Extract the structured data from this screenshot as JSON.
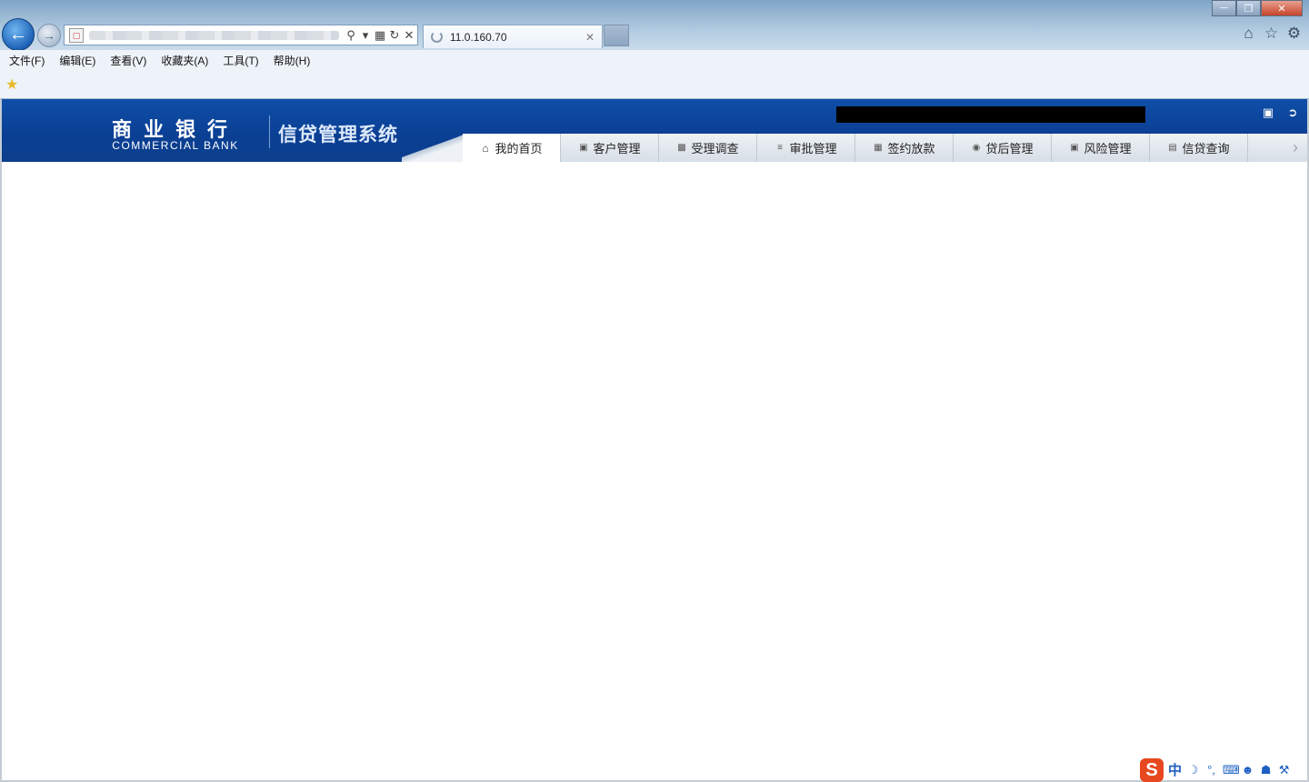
{
  "browser": {
    "tab_title": "11.0.160.70",
    "menu": [
      "文件(F)",
      "编辑(E)",
      "查看(V)",
      "收藏夹(A)",
      "工具(T)",
      "帮助(H)"
    ]
  },
  "app": {
    "brand_cn": "商业银行",
    "brand_en": "COMMERCIAL BANK",
    "system_name": "信贷管理系统",
    "nav_tabs": [
      {
        "label": "我的首页",
        "icon": "home-icon",
        "active": true
      },
      {
        "label": "客户管理",
        "icon": "customer-icon",
        "active": false
      },
      {
        "label": "受理调查",
        "icon": "survey-icon",
        "active": false
      },
      {
        "label": "审批管理",
        "icon": "approval-icon",
        "active": false
      },
      {
        "label": "签约放款",
        "icon": "contract-icon",
        "active": false
      },
      {
        "label": "贷后管理",
        "icon": "postloan-icon",
        "active": false
      },
      {
        "label": "风险管理",
        "icon": "risk-icon",
        "active": false
      },
      {
        "label": "信贷查询",
        "icon": "query-icon",
        "active": false
      }
    ]
  },
  "ime": {
    "logo": "S",
    "mode": "中"
  },
  "colors": {
    "header_blue": "#0a3f93",
    "nav_bg": "#e6ebf1",
    "ime_orange": "#e8481f"
  }
}
